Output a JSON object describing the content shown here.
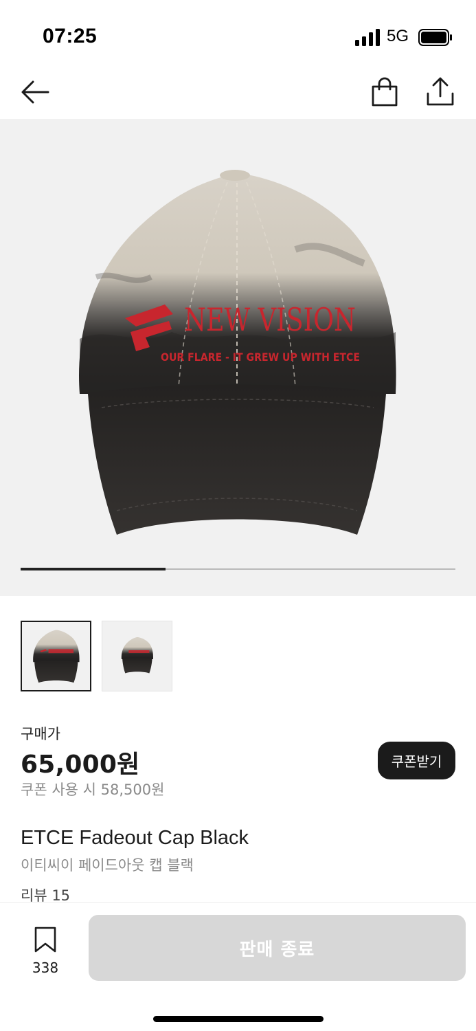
{
  "status_bar": {
    "time": "07:25",
    "network": "5G"
  },
  "nav": {
    "back_icon": "arrow-left-icon",
    "bag_icon": "shopping-bag-icon",
    "share_icon": "share-upload-icon"
  },
  "gallery": {
    "current_index": 1,
    "total": 3,
    "progress": 0.333,
    "embroidery_main": "NEW VISION",
    "embroidery_sub": "OUR FLARE - IT GREW UP WITH ETCE"
  },
  "price": {
    "label": "구매가",
    "amount": "65,000원",
    "coupon_price": "쿠폰 사용 시 58,500원",
    "coupon_button": "쿠폰받기"
  },
  "product": {
    "name": "ETCE Fadeout Cap Black",
    "name_korean": "이티씨이 페이드아웃 캡 블랙",
    "reviews": "리뷰 15"
  },
  "bottom_bar": {
    "wish_count": "338",
    "purchase_button": "판매 종료"
  },
  "colors": {
    "accent": "#1b1b1b",
    "disabled_button": "#d7d7d7",
    "embroidery_red": "#c8262e",
    "muted_text": "#8a8a8a"
  }
}
